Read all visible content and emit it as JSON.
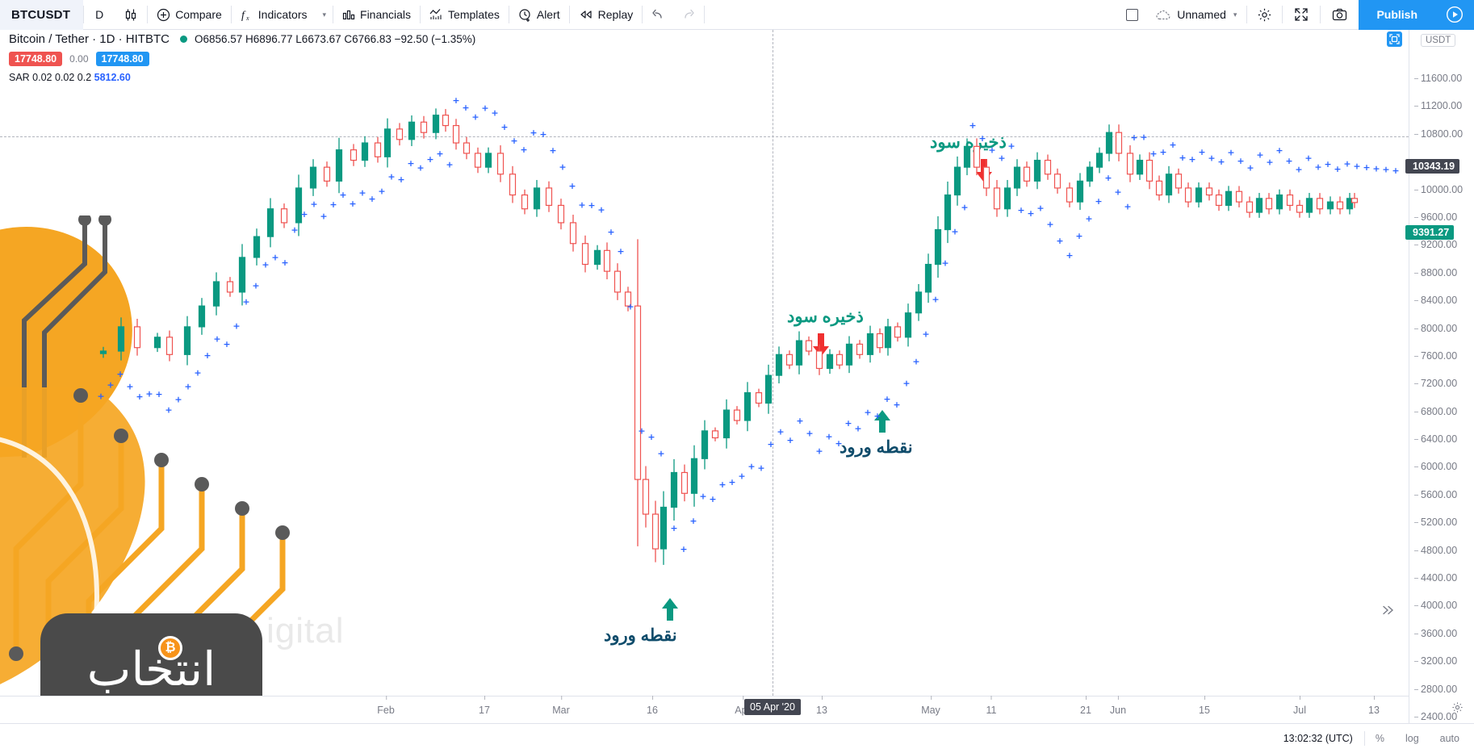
{
  "toolbar": {
    "symbol": "BTCUSDT",
    "interval": "D",
    "candle_icon": "candlestick-icon",
    "compare": "Compare",
    "indicators": "Indicators",
    "financials": "Financials",
    "templates": "Templates",
    "alert": "Alert",
    "replay": "Replay",
    "undo_icon": "undo-icon",
    "redo_icon": "redo-icon",
    "layout_icon": "layout-icon",
    "layout_name": "Unnamed",
    "settings_icon": "gear-icon",
    "fullscreen_icon": "fullscreen-icon",
    "snapshot_icon": "camera-icon",
    "publish": "Publish",
    "play_icon": "play-icon"
  },
  "legend": {
    "title": "Bitcoin / Tether · 1D · HITBTC",
    "ohlc": "O6856.57 H6896.77 L6673.67 C6766.83 −92.50 (−1.35%)",
    "vol_red": "17748.80",
    "vol_zero": "0.00",
    "vol_blue": "17748.80",
    "sar_label": "SAR 0.02 0.02 0.2",
    "sar_value": "5812.60"
  },
  "price_axis": {
    "unit": "USDT",
    "ticks": [
      "11600.00",
      "11200.00",
      "10800.00",
      "10000.00",
      "9600.00",
      "9200.00",
      "8800.00",
      "8400.00",
      "8000.00",
      "7600.00",
      "7200.00",
      "6800.00",
      "6400.00",
      "6000.00",
      "5600.00",
      "5200.00",
      "4800.00",
      "4400.00",
      "4000.00",
      "3600.00",
      "3200.00",
      "2800.00",
      "2400.00"
    ],
    "crosshair_price": "10343.19",
    "last_price": "9391.27"
  },
  "time_axis": {
    "ticks": [
      "Feb",
      "17",
      "Mar",
      "16",
      "Apr",
      "13",
      "May",
      "11",
      "21",
      "Jun",
      "15",
      "Jul",
      "13"
    ],
    "crosshair_date": "05 Apr '20"
  },
  "statusbar": {
    "time": "13:02:32 (UTC)",
    "percent": "%",
    "log": "log",
    "auto": "auto",
    "gear_icon": "gear-icon"
  },
  "annotations": [
    {
      "text": "ذخیره سود",
      "type": "take-profit",
      "arrow": "down",
      "color": "#0a9981"
    },
    {
      "text": "ذخیره سود",
      "type": "take-profit",
      "arrow": "down",
      "color": "#0a9981"
    },
    {
      "text": "نقطه ورود",
      "type": "entry-point",
      "arrow": "up",
      "color": "#0f4c6b"
    },
    {
      "text": "نقطه ورود",
      "type": "entry-point",
      "arrow": "up",
      "color": "#0f4c6b"
    }
  ],
  "watermark": {
    "text": "igital"
  },
  "logo": {
    "text": "انتخاب",
    "coin": "₿"
  },
  "colors": {
    "accent": "#2196f3",
    "bull": "#0a9981",
    "bear": "#ef5350",
    "sar": "#2962ff",
    "grid": "#e0e3eb",
    "text_muted": "#787b86",
    "arrow_down": "#ef3030",
    "arrow_up": "#0a9981"
  },
  "chart_data": {
    "type": "candlestick",
    "title": "Bitcoin / Tether · 1D · HITBTC",
    "ylabel": "USDT",
    "ylim": [
      2400,
      11600
    ],
    "ytick_step": 400,
    "xlabel": "",
    "series": [
      {
        "name": "BTCUSDT OHLC",
        "type": "candle"
      },
      {
        "name": "SAR 0.02 0.02 0.2",
        "type": "dots",
        "color": "#2962ff"
      }
    ]
  }
}
